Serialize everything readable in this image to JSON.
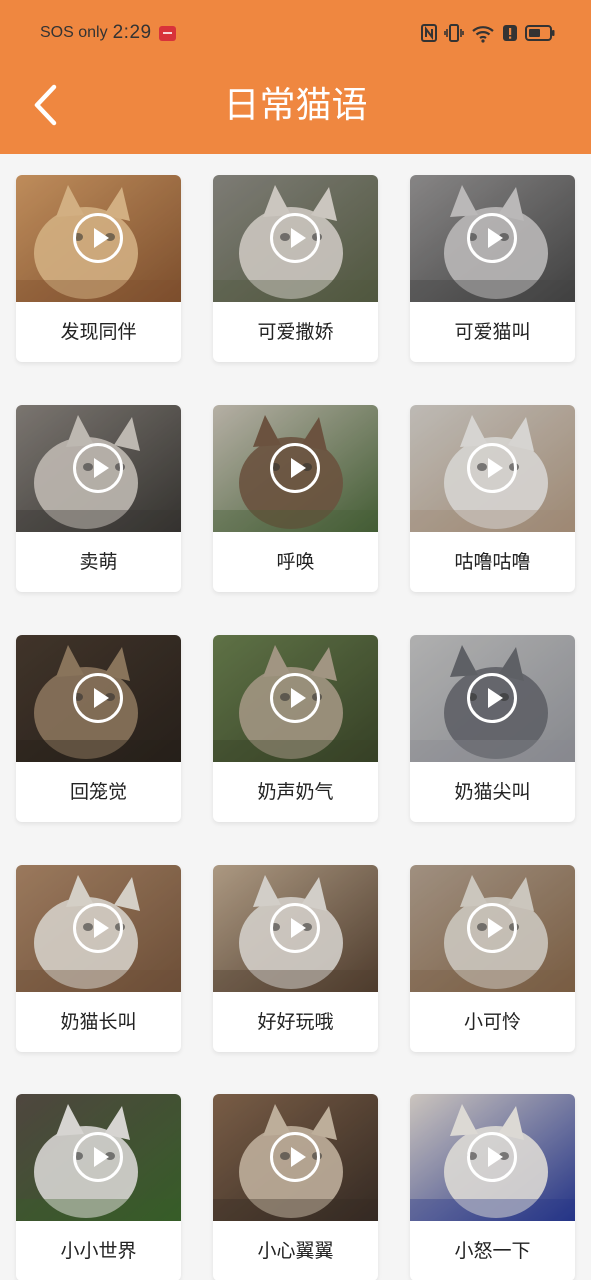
{
  "status_bar": {
    "carrier": "SOS only",
    "time": "2:29",
    "icons": [
      "notification-app-icon",
      "nfc-icon",
      "vibrate-icon",
      "wifi-icon",
      "alert-icon",
      "battery-icon"
    ]
  },
  "header": {
    "title": "日常猫语",
    "back_icon": "chevron-left-icon",
    "color": "#ef8740"
  },
  "cards": [
    {
      "label": "发现同伴",
      "colors": [
        "#d9a068",
        "#f0c894",
        "#8e5a34"
      ]
    },
    {
      "label": "可爱撒娇",
      "colors": [
        "#8f8d86",
        "#e8e2da",
        "#5c6448"
      ]
    },
    {
      "label": "可爱猫叫",
      "colors": [
        "#9a9898",
        "#d4d2d2",
        "#4a4a4a"
      ]
    },
    {
      "label": "卖萌",
      "colors": [
        "#8c8680",
        "#d8d2ca",
        "#3c3a36"
      ]
    },
    {
      "label": "呼唤",
      "colors": [
        "#cfc8bc",
        "#7a5e48",
        "#4d6a3c"
      ]
    },
    {
      "label": "咕噜咕噜",
      "colors": [
        "#d8d4ce",
        "#f4f2ee",
        "#b49c84"
      ]
    },
    {
      "label": "回笼觉",
      "colors": [
        "#4a3c30",
        "#9c8468",
        "#2c241e"
      ]
    },
    {
      "label": "奶声奶气",
      "colors": [
        "#6c8250",
        "#b8aa94",
        "#3e4a2c"
      ]
    },
    {
      "label": "奶猫尖叫",
      "colors": [
        "#c8c8c8",
        "#6c6e74",
        "#9a9ca2"
      ]
    },
    {
      "label": "奶猫长叫",
      "colors": [
        "#b08a6a",
        "#f2ece2",
        "#7c5a40"
      ]
    },
    {
      "label": "好好玩哦",
      "colors": [
        "#c4ae94",
        "#f0ebe4",
        "#5a4534"
      ]
    },
    {
      "label": "小可怜",
      "colors": [
        "#b6a492",
        "#e8e2d8",
        "#8a6a4c"
      ]
    },
    {
      "label": "小小世界",
      "colors": [
        "#5a5048",
        "#f4f2ee",
        "#3e6a2e"
      ]
    },
    {
      "label": "小心翼翼",
      "colors": [
        "#8a6a50",
        "#d8c6b0",
        "#3c3028"
      ]
    },
    {
      "label": "小怒一下",
      "colors": [
        "#e8e0d8",
        "#fbf7f2",
        "#2a3c9a"
      ]
    }
  ]
}
